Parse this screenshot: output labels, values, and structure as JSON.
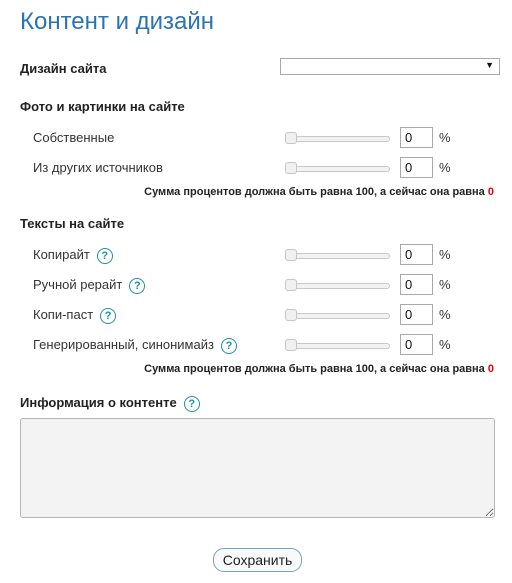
{
  "page": {
    "title": "Контент и дизайн"
  },
  "design": {
    "label": "Дизайн сайта",
    "selected": ""
  },
  "photos": {
    "heading": "Фото и картинки на сайте",
    "rows": [
      {
        "label": "Собственные",
        "value": "0",
        "unit": "%"
      },
      {
        "label": "Из других источников",
        "value": "0",
        "unit": "%"
      }
    ],
    "sum_note": "Сумма процентов должна быть равна 100, а сейчас она равна",
    "sum_value": "0"
  },
  "texts": {
    "heading": "Тексты на сайте",
    "rows": [
      {
        "label": "Копирайт",
        "value": "0",
        "unit": "%"
      },
      {
        "label": "Ручной рерайт",
        "value": "0",
        "unit": "%"
      },
      {
        "label": "Копи-паст",
        "value": "0",
        "unit": "%"
      },
      {
        "label": "Генерированный, синонимайз",
        "value": "0",
        "unit": "%"
      }
    ],
    "sum_note": "Сумма процентов должна быть равна 100, а сейчас она равна",
    "sum_value": "0"
  },
  "info": {
    "label": "Информация о контенте",
    "value": ""
  },
  "help_icon_glyph": "?",
  "select_arrow_glyph": "▼",
  "save_label": "Сохранить",
  "colors": {
    "title": "#2a73b5",
    "help_icon": "#1e8fa8",
    "sum_value": "#e00000"
  }
}
